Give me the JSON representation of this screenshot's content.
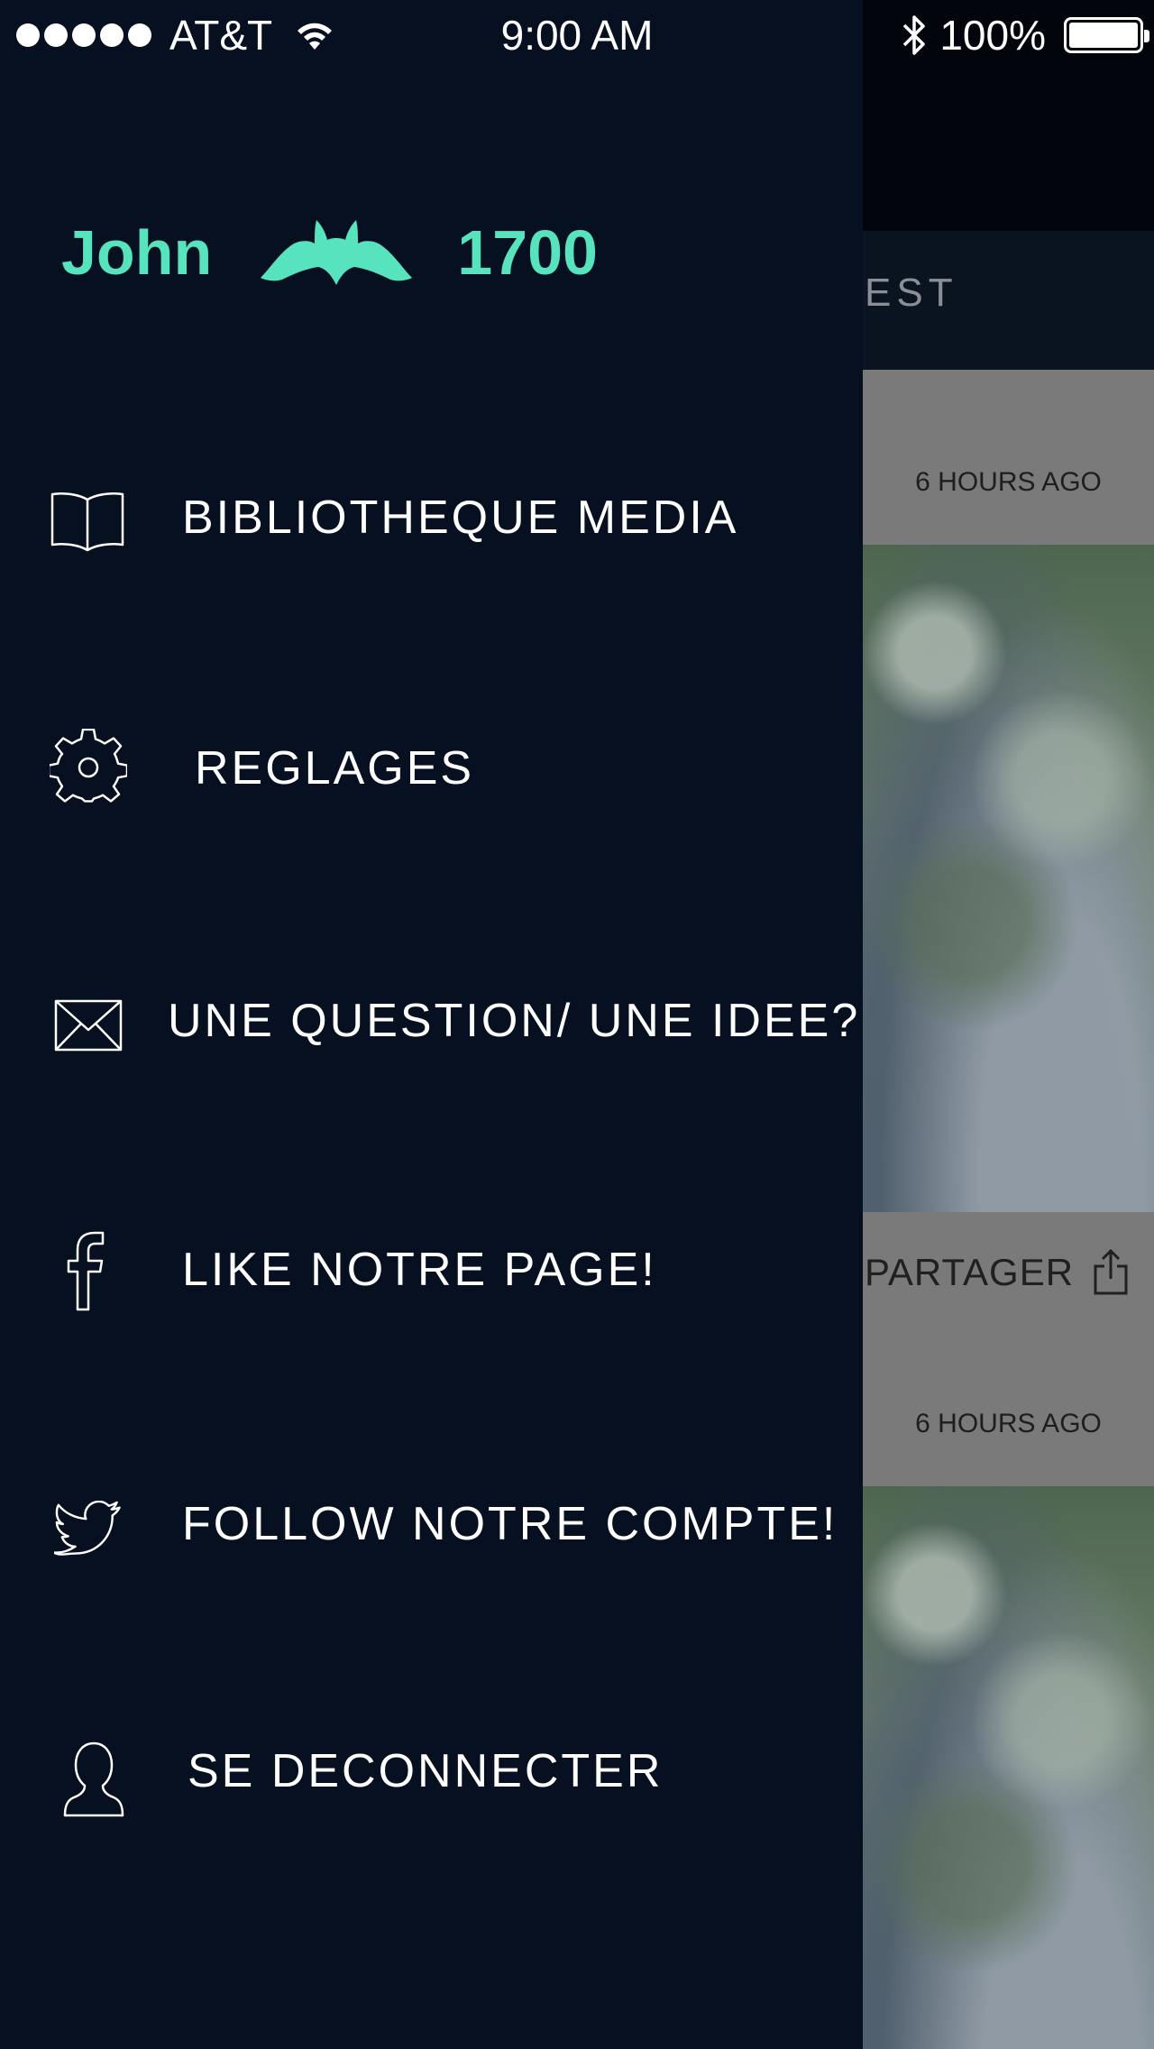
{
  "status_bar": {
    "carrier": "AT&T",
    "time": "9:00 AM",
    "battery": "100%",
    "battery_level": 1.0,
    "signal_bars": 5
  },
  "profile": {
    "name": "John",
    "points": "1700",
    "logo_icon": "bat-icon",
    "accent_color": "#56e3bd"
  },
  "menu": {
    "items": [
      {
        "icon": "book-icon",
        "label": "BIBLIOTHEQUE MEDIA"
      },
      {
        "icon": "gear-icon",
        "label": "REGLAGES"
      },
      {
        "icon": "envelope-icon",
        "label": "UNE QUESTION/ UNE IDEE?"
      },
      {
        "icon": "facebook-icon",
        "label": "LIKE NOTRE PAGE!"
      },
      {
        "icon": "twitter-icon",
        "label": "FOLLOW NOTRE COMPTE!"
      },
      {
        "icon": "user-icon",
        "label": "SE DECONNECTER"
      }
    ]
  },
  "feed": {
    "tab_label": "EST",
    "cards": [
      {
        "time": "6 HOURS AGO"
      },
      {
        "time": "6 HOURS AGO"
      }
    ],
    "share_label": "PARTAGER",
    "share_icon": "share-icon"
  },
  "colors": {
    "drawer_background": "#061020",
    "menu_text": "#ffffff"
  }
}
